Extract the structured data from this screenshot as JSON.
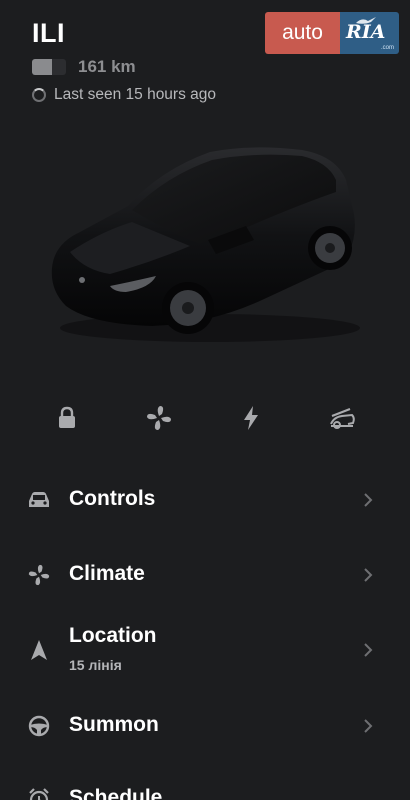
{
  "header": {
    "car_name": "ILI",
    "battery_level": 0.6,
    "range": "161 km",
    "last_seen": "Last seen 15 hours ago"
  },
  "logo": {
    "auto_text": "auto",
    "ria_text": "RIA",
    "com_text": ".com",
    "auto_color": "#c85a4f",
    "ria_color": "#2f5e86"
  },
  "quick_actions": [
    "lock-icon",
    "fan-icon",
    "lightning-icon",
    "frunk-icon"
  ],
  "menu": {
    "controls": {
      "label": "Controls",
      "icon": "car-icon"
    },
    "climate": {
      "label": "Climate",
      "icon": "fan-icon"
    },
    "location": {
      "label": "Location",
      "sub": "15 лінія",
      "icon": "navigation-arrow-icon"
    },
    "summon": {
      "label": "Summon",
      "icon": "steering-wheel-icon"
    },
    "schedule": {
      "label": "Schedule",
      "icon": "alarm-clock-icon"
    }
  },
  "colors": {
    "background": "#1c1d1f",
    "text_primary": "#ffffff",
    "text_secondary": "#b7b8bb",
    "icon_gray": "#a9aaad"
  }
}
